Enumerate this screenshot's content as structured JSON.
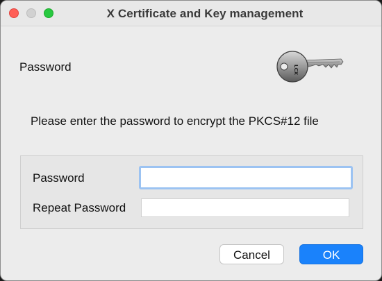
{
  "window": {
    "title": "X Certificate and Key management"
  },
  "dialog": {
    "heading": "Password",
    "key_icon": "key-icon",
    "info_text": "Please enter the password to encrypt the PKCS#12 file",
    "password_label": "Password",
    "password_value": "",
    "repeat_label": "Repeat Password",
    "repeat_value": "",
    "cancel_label": "Cancel",
    "ok_label": "OK"
  },
  "colors": {
    "accent": "#1a82fb",
    "focus_ring": "#9cc3f2",
    "close": "#ff5f57",
    "maximize": "#28c840",
    "minimize_disabled": "#d1d1d1"
  }
}
